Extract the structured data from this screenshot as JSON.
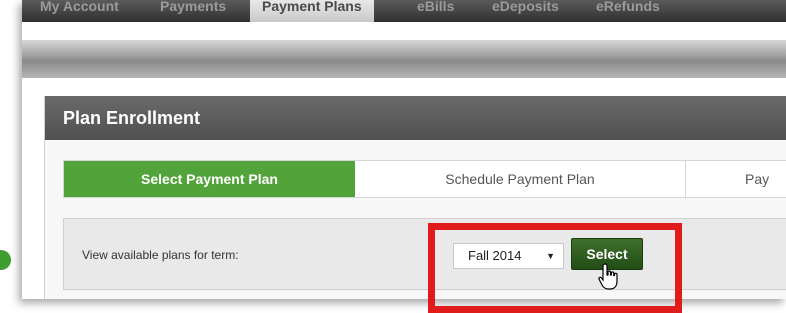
{
  "nav": {
    "tabs": [
      {
        "label": "My Account"
      },
      {
        "label": "Payments"
      },
      {
        "label": "Payment Plans",
        "active": true
      },
      {
        "label": "eBills"
      },
      {
        "label": "eDeposits"
      },
      {
        "label": "eRefunds"
      }
    ]
  },
  "panel": {
    "title": "Plan Enrollment",
    "steps": [
      {
        "label": "Select Payment Plan",
        "active": true
      },
      {
        "label": "Schedule Payment Plan"
      },
      {
        "label": "Pay"
      }
    ],
    "term_label": "View available plans for term:",
    "term_selected": "Fall 2014",
    "select_button": "Select"
  },
  "colors": {
    "accent_green": "#52a33a",
    "button_green": "#2e5e21",
    "highlight_red": "#e01b1b",
    "header_gray": "#5a5a5a"
  }
}
